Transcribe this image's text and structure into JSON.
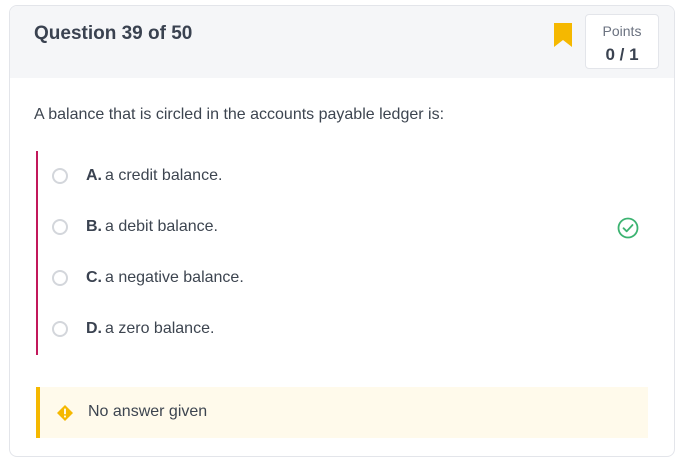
{
  "header": {
    "title": "Question 39 of 50",
    "points_label": "Points",
    "points_value": "0 / 1"
  },
  "question": {
    "text": "A balance that is circled in the accounts payable ledger is:",
    "options": [
      {
        "letter": "A.",
        "text": "a credit balance.",
        "correct": false
      },
      {
        "letter": "B.",
        "text": "a debit balance.",
        "correct": true
      },
      {
        "letter": "C.",
        "text": "a negative balance.",
        "correct": false
      },
      {
        "letter": "D.",
        "text": "a zero balance.",
        "correct": false
      }
    ]
  },
  "notice": {
    "text": "No answer given"
  },
  "icons": {
    "bookmark": "bookmark-icon",
    "correct": "check-circle-icon",
    "warning": "warning-diamond-icon"
  },
  "colors": {
    "accent_bar": "#c2185b",
    "bookmark": "#f5b800",
    "correct": "#3cb371",
    "notice_bg": "#fffaeb",
    "notice_border": "#f5b800"
  }
}
